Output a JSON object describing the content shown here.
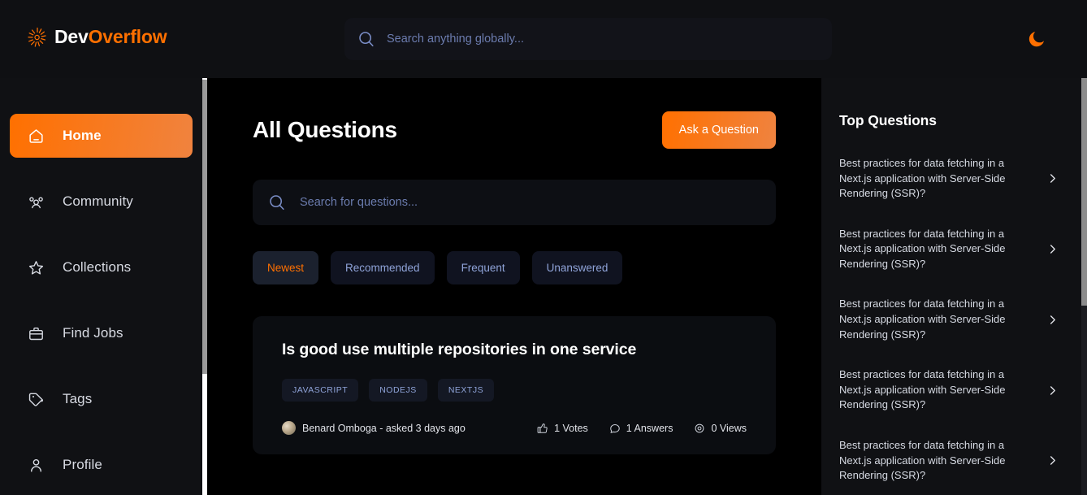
{
  "navbar": {
    "logo": {
      "icon": "sunburst-icon",
      "text_primary": "Dev",
      "text_accent": "Overflow"
    },
    "global_search": {
      "icon": "search-icon",
      "placeholder": "Search anything globally...",
      "value": ""
    },
    "theme_toggle": {
      "icon": "moon-icon",
      "state": "dark"
    }
  },
  "sidebar": {
    "items": [
      {
        "label": "Home",
        "icon": "home-icon",
        "active": true
      },
      {
        "label": "Community",
        "icon": "users-icon",
        "active": false
      },
      {
        "label": "Collections",
        "icon": "star-icon",
        "active": false
      },
      {
        "label": "Find Jobs",
        "icon": "briefcase-icon",
        "active": false
      },
      {
        "label": "Tags",
        "icon": "tag-icon",
        "active": false
      },
      {
        "label": "Profile",
        "icon": "user-icon",
        "active": false
      }
    ]
  },
  "main": {
    "title": "All Questions",
    "ask_button": "Ask a Question",
    "search": {
      "icon": "search-icon",
      "placeholder": "Search for questions...",
      "value": ""
    },
    "filters": [
      {
        "label": "Newest",
        "active": true
      },
      {
        "label": "Recommended",
        "active": false
      },
      {
        "label": "Frequent",
        "active": false
      },
      {
        "label": "Unanswered",
        "active": false
      }
    ],
    "questions": [
      {
        "title": "Is good use multiple repositories in one service",
        "tags": [
          "JAVASCRIPT",
          "NODEJS",
          "NEXTJS"
        ],
        "author": "Benard Omboga - asked 3 days ago",
        "stats": [
          {
            "icon": "thumbs-up-icon",
            "text": "1 Votes"
          },
          {
            "icon": "message-icon",
            "text": "1 Answers"
          },
          {
            "icon": "eye-icon",
            "text": "0 Views"
          }
        ]
      }
    ]
  },
  "right_sidebar": {
    "title": "Top Questions",
    "items": [
      {
        "text": "Best practices for data fetching in a Next.js application with Server-Side Rendering (SSR)?",
        "icon": "chevron-right-icon"
      },
      {
        "text": "Best practices for data fetching in a Next.js application with Server-Side Rendering (SSR)?",
        "icon": "chevron-right-icon"
      },
      {
        "text": "Best practices for data fetching in a Next.js application with Server-Side Rendering (SSR)?",
        "icon": "chevron-right-icon"
      },
      {
        "text": "Best practices for data fetching in a Next.js application with Server-Side Rendering (SSR)?",
        "icon": "chevron-right-icon"
      },
      {
        "text": "Best practices for data fetching in a Next.js application with Server-Side Rendering (SSR)?",
        "icon": "chevron-right-icon"
      }
    ]
  },
  "colors": {
    "accent": "#ff7000",
    "accent_gradient_end": "#f0833f",
    "panel_bg": "#101114",
    "center_bg": "#000000",
    "card_bg": "#0b0d11",
    "muted_text": "#7b8ec8"
  }
}
